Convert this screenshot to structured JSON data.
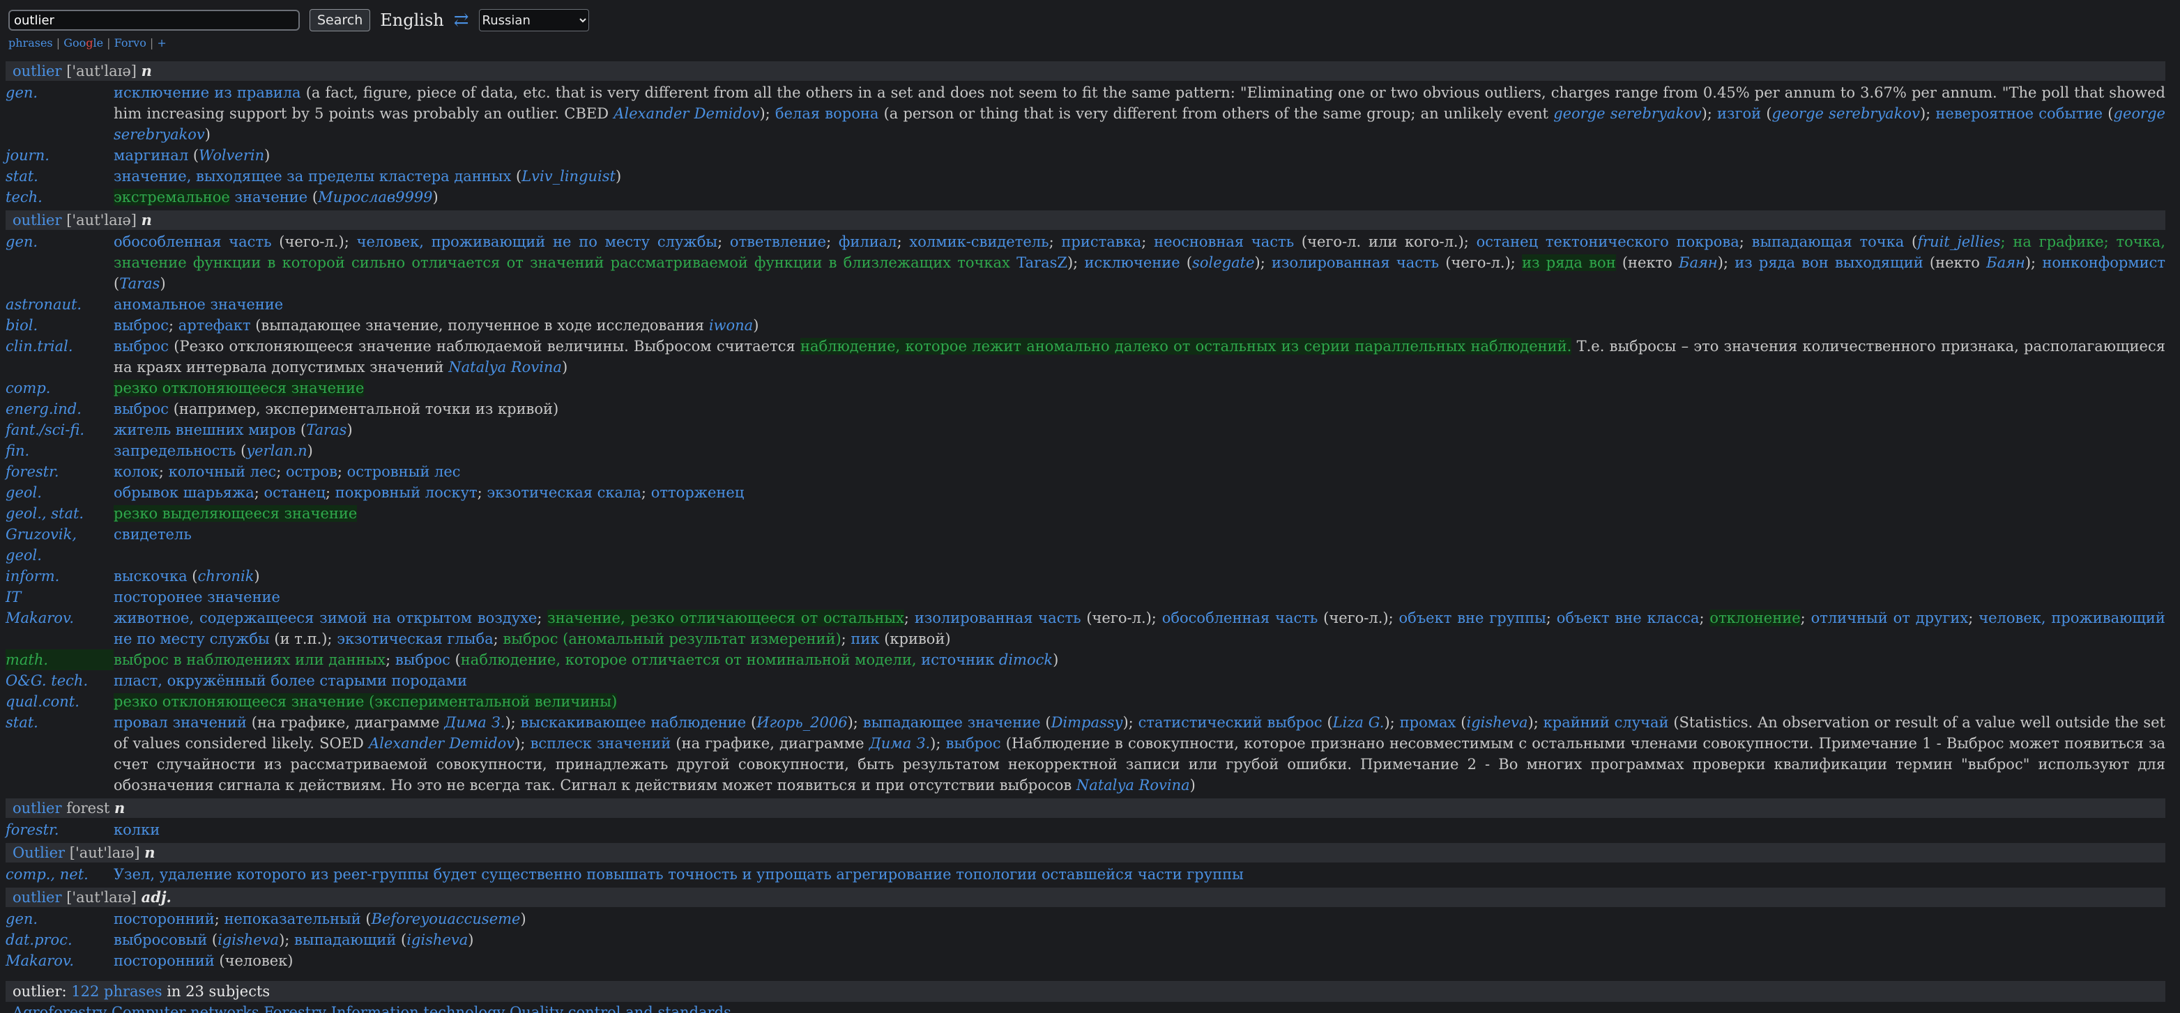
{
  "search": {
    "value": "outlier",
    "button": "Search"
  },
  "lang": {
    "from": "English",
    "swap_icon": "⇄",
    "to": "Russian"
  },
  "sublinks": {
    "phrases": "phrases",
    "sep1": " | ",
    "g1": "Goo",
    "g2": "g",
    "g3": "le",
    "sep2": " | ",
    "forvo": "Forvo",
    "sep3": " | ",
    "plus": "+"
  },
  "h1": {
    "term": "outlier",
    "pron": " ['aut'laɪə] ",
    "pos": "n"
  },
  "h2": {
    "term": "outlier",
    "pron": " ['aut'laɪə] ",
    "pos": "n"
  },
  "h3": {
    "term": "outlier",
    "pron": " forest ",
    "pos": "n"
  },
  "h4": {
    "term": "Outlier",
    "pron": " ['aut'laɪə] ",
    "pos": "n"
  },
  "h5": {
    "term": "outlier",
    "pron": " ['aut'laɪə] ",
    "pos": "adj."
  },
  "s": {
    "gen": "gen.",
    "journ": "journ.",
    "stat": "stat.",
    "tech": "tech.",
    "gen2": "gen.",
    "astronaut": "astronaut.",
    "biol": "biol.",
    "clin": "clin.trial.",
    "comp": "comp.",
    "energ": "energ.ind.",
    "fant": "fant./sci-fi.",
    "fin": "fin.",
    "forestr": "forestr.",
    "geol": "geol.",
    "geolstat": "geol., stat.",
    "gruz": "Gruzovik, geol.",
    "inform": "inform.",
    "it": "IT",
    "makarov": "Makarov.",
    "math": "math.",
    "og": "O&G. tech.",
    "qual": "qual.cont.",
    "stat2": "stat.",
    "forestr2": "forestr.",
    "compnet": "comp., net.",
    "gen3": "gen.",
    "datproc": "dat.proc.",
    "makarov2": "Makarov."
  },
  "r1": {
    "t1": "исключение из правила",
    "d1": " (a fact, figure, piece of data, etc. that is very different from all the others in a set and does not seem to fit the same pattern: \"Eliminating one or two obvious outliers, charges range from 0.45% per annum to 3.67% per annum. \"The poll that showed him increasing support by 5 points was probably an outlier. CBED ",
    "a1": "Alexander Demidov",
    "d2": "); ",
    "t2": "белая ворона",
    "d3": " (a person or thing that is very different from others of the same group; an unlikely event ",
    "a2": "george serebryakov",
    "d4": "); ",
    "t3": "изгой",
    "d5": " (",
    "a3": "george serebryakov",
    "d6": "); ",
    "t4": "невероятное событие",
    "d7": " (",
    "a4": "george serebryakov",
    "d8": ")"
  },
  "r2": {
    "t1": "маргинал",
    "d1": " (",
    "a1": "Wolverin",
    "d2": ")"
  },
  "r3": {
    "t1": "значение, выходящее за пределы кластера данных",
    "d1": " (",
    "a1": "Lviv_linguist",
    "d2": ")"
  },
  "r4": {
    "h1": "экстремальное",
    "t1": " значение",
    "d1": " (",
    "a1": "Мирослав9999",
    "d2": ")"
  },
  "r5": {
    "t1": "обособленная часть",
    "d1": " (чего-л.); ",
    "t2": "человек, проживающий не по месту службы",
    "d2": "; ",
    "t3": "ответвление",
    "d3": "; ",
    "t4": "филиал",
    "d4": "; ",
    "t5": "холмик-свидетель",
    "d5": "; ",
    "t6": "приставка",
    "d6": "; ",
    "t7": "неосновная часть",
    "d7": " (чего-л. или кого-л.); ",
    "t8": "останец тектонического покрова",
    "d8": "; ",
    "t9": "выпадающая точка",
    "d9": " (",
    "a1": "fruit_jellies",
    "p1": "; на графике; точка, значение функции в которой сильно отличается от значений рассматриваемой функции в близлежащих точках",
    "a2": " TarasZ",
    "d10": "); ",
    "t10": "исключение",
    "d11": " (",
    "a3": "solegate",
    "d12": "); ",
    "t11": "изолированная часть",
    "d13": " (чего-л.); ",
    "h1": "из ряда вон",
    "d14": " (некто ",
    "a4": "Баян",
    "d15": "); ",
    "t12": "из ряда вон выходящий",
    "d16": " (некто ",
    "a5": "Баян",
    "d17": "); ",
    "t13": "нонконформист",
    "d18": " (",
    "a6": "Taras",
    "d19": ")"
  },
  "r6": {
    "t1": "аномальное значение"
  },
  "r7": {
    "t1": "выброс",
    "d1": "; ",
    "t2": "артефакт",
    "d2": " (выпадающее значение, полученное в ходе исследования ",
    "a1": "iwona",
    "d3": ")"
  },
  "r8": {
    "t1": "выброс",
    "d1": " (Резко отклоняющееся значение наблюдаемой величины. Выбросом считается ",
    "h1": "наблюдение, которое лежит аномально далеко от остальных из серии параллельных наблюдений.",
    "d2": " Т.е. выбросы – это значения количественного признака, располагающиеся на краях интервала допустимых значений ",
    "a1": "Natalya Rovina",
    "d3": ")"
  },
  "r9": {
    "h1": "резко отклоняющееся значение"
  },
  "r10": {
    "t1": "выброс",
    "d1": " (например, экспериментальной точки из кривой)"
  },
  "r11": {
    "t1": "житель внешних миров",
    "d1": " (",
    "a1": "Taras",
    "d2": ")"
  },
  "r12": {
    "t1": "запредельность",
    "d1": " (",
    "a1": "yerlan.n",
    "d2": ")"
  },
  "r13": {
    "t1": "колок",
    "d1": "; ",
    "t2": "колочный лес",
    "d2": "; ",
    "t3": "остров",
    "d3": "; ",
    "t4": "островный лес"
  },
  "r14": {
    "t1": "обрывок шарьяжа",
    "d1": "; ",
    "t2": "останец",
    "d2": "; ",
    "t3": "покровный лоскут",
    "d3": "; ",
    "t4": "экзотическая скала",
    "d4": "; ",
    "t5": "отторженец"
  },
  "r15": {
    "h1": "резко выделяющееся значение"
  },
  "r16": {
    "t1": "свидетель"
  },
  "r17": {
    "t1": "выскочка",
    "d1": " (",
    "a1": "chronik",
    "d2": ")"
  },
  "r18": {
    "t1": "посторонее значение"
  },
  "r19": {
    "t1": "животное, содержащееся зимой на открытом воздухе",
    "d1": "; ",
    "h1": "значение, резко отличающееся от остальных",
    "d2": "; ",
    "t2": "изолированная часть",
    "d3": " (чего-л.); ",
    "t3": "обособленная часть",
    "d4": " (чего-л.); ",
    "t4": "объект вне группы",
    "d5": "; ",
    "t5": "объект вне класса",
    "d6": "; ",
    "h2": "отклонение",
    "d7": "; ",
    "t6": "отличный от других",
    "d8": "; ",
    "t7": "человек, проживающий не по месту службы",
    "d9": " (и т.п.); ",
    "t8": "экзотическая глыба",
    "d10": "; ",
    "h3": "выброс (аномальный результат измерений)",
    "d11": "; ",
    "t9": "пик",
    "d12": " (кривой)"
  },
  "r20": {
    "h1": "выброс в наблюдениях или данных",
    "d1": "; ",
    "t1": "выброс",
    "d2": " (",
    "p1": "наблюдение, которое отличается от номинальной модели,",
    "a1": " источник ",
    "a2": "dimock",
    "d3": ")"
  },
  "r21": {
    "t1": "пласт, окружённый более старыми породами"
  },
  "r22": {
    "h1": "резко отклоняющееся значение (экспериментальной величины)"
  },
  "r23": {
    "t1": "провал значений",
    "d1": " (на графике, диаграмме ",
    "a1": "Дима З.",
    "d2": "); ",
    "t2": "выскакивающее наблюдение",
    "d3": " (",
    "a2": "Игорь_2006",
    "d4": "); ",
    "t3": "выпадающее значение",
    "d5": " (",
    "a3": "Dimpassy",
    "d6": "); ",
    "t4": "статистический выброс",
    "d7": " (",
    "a4": "Liza G.",
    "d8": "); ",
    "t5": "промах",
    "d9": " (",
    "a5": "igisheva",
    "d10": "); ",
    "t6": "крайний случай",
    "d11": " (Statistics. An observation or result of a value well outside the set of values considered likely. SOED ",
    "a6": "Alexander Demidov",
    "d12": "); ",
    "t7": "всплеск значений",
    "d13": " (на графике, диаграмме ",
    "a7": "Дима З.",
    "d14": "); ",
    "t8": "выброс",
    "d15": " (Наблюдение в совокупности, которое признано несовместимым с остальными членами совокупности. Примечание 1 - Выброс может появиться за счет случайности из рассматриваемой совокупности, принадлежать другой совокупности, быть результатом некорректной записи или грубой ошибки. Примечание 2 - Во многих программах проверки квалификации термин \"выброс\" используют для обозначения сигнала к действиям. Но это не всегда так. Сигнал к действиям может появиться и при отсутствии выбросов ",
    "a8": "Natalya Rovina",
    "d16": ")"
  },
  "r24": {
    "t1": "колки"
  },
  "r25": {
    "t1": "Узел, удаление которого из peer-группы будет существенно повышать точность и упрощать агрегирование топологии оставшейся части группы"
  },
  "r26": {
    "t1": "посторонний",
    "d1": "; ",
    "t2": "непоказательный",
    "d2": " (",
    "a1": "Beforeyouaccuseme",
    "d3": ")"
  },
  "r27": {
    "t1": "выбросовый",
    "d1": " (",
    "a1": "igisheva",
    "d2": "); ",
    "t2": "выпадающий",
    "d3": " (",
    "a2": "igisheva",
    "d4": ")"
  },
  "r28": {
    "t1": "посторонний",
    "d1": " (человек)"
  },
  "footer": {
    "pre": "outlier: ",
    "link": "122 phrases",
    "post": " in 23 subjects"
  },
  "bottom": {
    "text": "Agroforestry  Computer networks  Forestry  Information technology  Quality control and standards"
  }
}
